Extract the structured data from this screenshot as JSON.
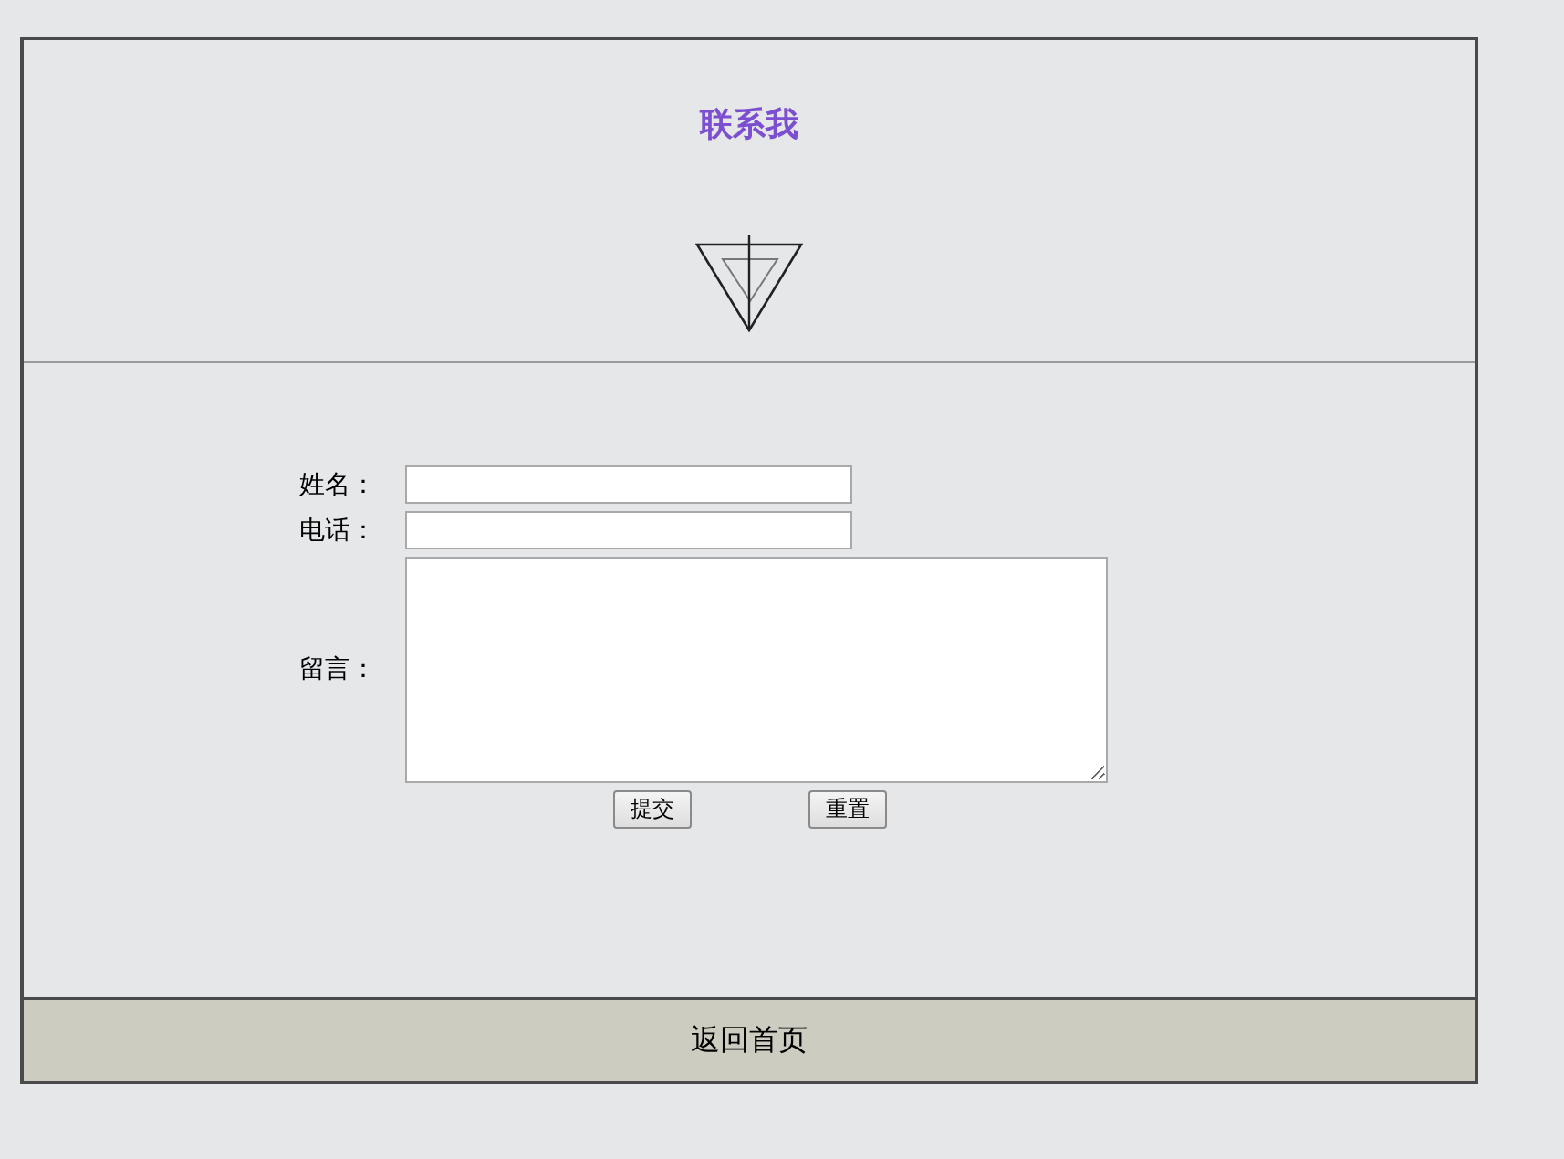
{
  "header": {
    "title": "联系我"
  },
  "form": {
    "fields": [
      {
        "label": "姓名：",
        "kind": "input"
      },
      {
        "label": "电话：",
        "kind": "input"
      },
      {
        "label": "留言：",
        "kind": "textarea"
      }
    ],
    "buttons": [
      "提交",
      "重置"
    ]
  },
  "footer": {
    "link": "返回首页"
  }
}
